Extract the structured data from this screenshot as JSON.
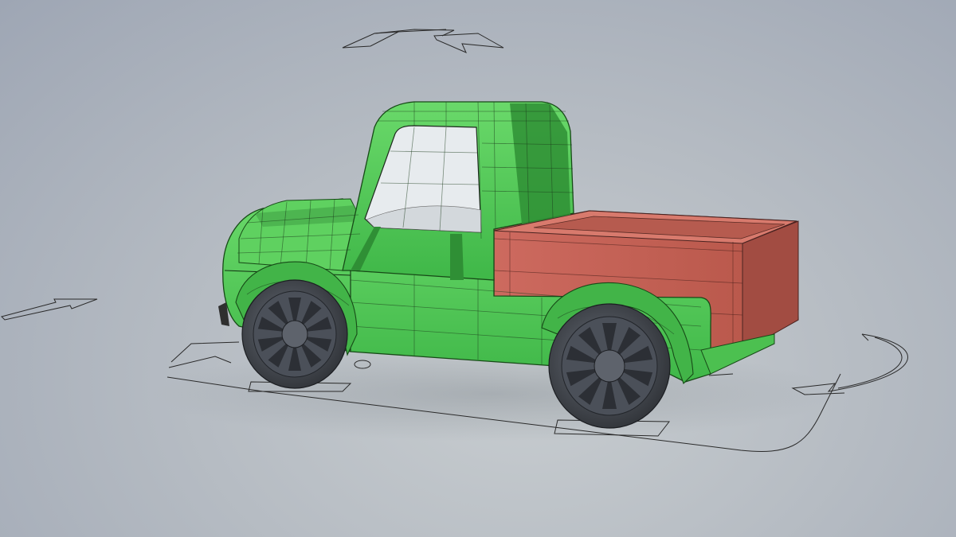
{
  "viewport": {
    "shading_mode": "wireframe-on-shaded",
    "background_top": "#9ea6b4",
    "background_bottom": "#c8cdd0"
  },
  "model": {
    "body_color": "#55cc55",
    "body_shadow_color": "#2f8f35",
    "bed_color": "#c9645a",
    "bed_shadow_color": "#9a4a42",
    "glass_color": "#e7ebee",
    "tire_color": "#3f4349",
    "rim_color": "#5a5f68"
  },
  "gizmos": {
    "icons": [
      "rotate-arrow-icon",
      "move-arrow-icon",
      "curved-arrow-icon",
      "ground-plane-outline"
    ]
  }
}
